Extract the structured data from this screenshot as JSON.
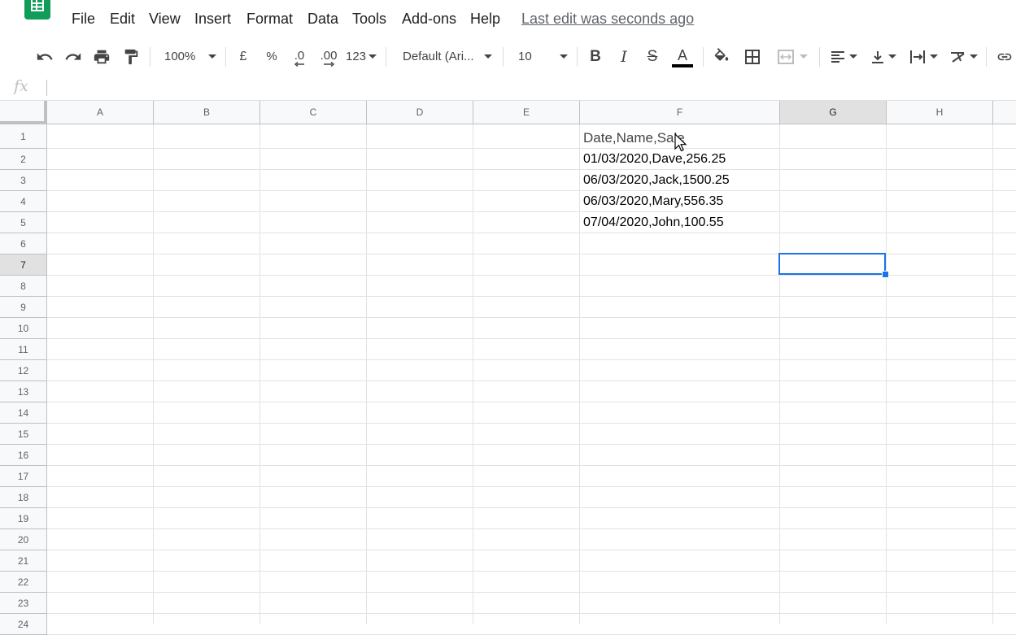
{
  "menubar": {
    "items": [
      "File",
      "Edit",
      "View",
      "Insert",
      "Format",
      "Data",
      "Tools",
      "Add-ons",
      "Help"
    ],
    "last_edit": "Last edit was seconds ago"
  },
  "toolbar": {
    "zoom": "100%",
    "currency": "£",
    "percent": "%",
    "decrease_decimal": ".0",
    "increase_decimal": ".00",
    "more_formats": "123",
    "font": "Default (Ari...",
    "font_size": "10",
    "bold": "B",
    "italic": "I",
    "strike": "S",
    "text_color_letter": "A"
  },
  "formula_bar": {
    "fx": "fx",
    "value": ""
  },
  "columns": [
    "A",
    "B",
    "C",
    "D",
    "E",
    "F",
    "G",
    "H"
  ],
  "selected_column": "G",
  "rows": [
    "1",
    "2",
    "3",
    "4",
    "5",
    "6",
    "7",
    "8",
    "9",
    "10",
    "11",
    "12",
    "13",
    "14",
    "15",
    "16",
    "17",
    "18",
    "19",
    "20",
    "21",
    "22",
    "23",
    "24"
  ],
  "selected_row": "7",
  "cells": {
    "F1": "Date,Name,Sale",
    "F2": "01/03/2020,Dave,256.25",
    "F3": "06/03/2020,Jack,1500.25",
    "F4": "06/03/2020,Mary,556.35",
    "F5": "07/04/2020,John,100.55"
  },
  "active_cell": "G7",
  "colors": {
    "brand": "#0f9d58",
    "selection": "#1a73e8"
  }
}
